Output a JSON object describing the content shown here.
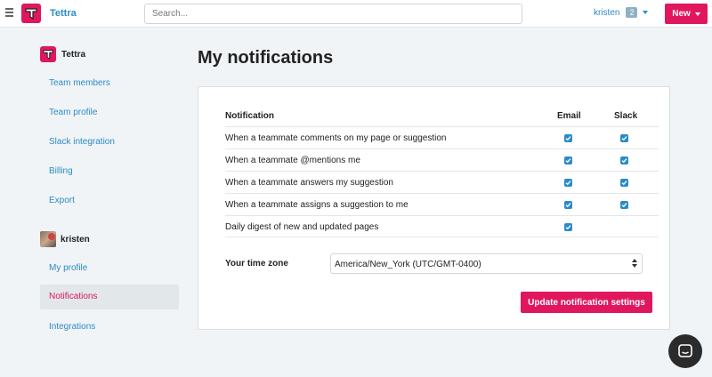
{
  "app": {
    "brand": "Tettra"
  },
  "search": {
    "placeholder": "Search..."
  },
  "user_menu": {
    "name": "kristen",
    "count": "2"
  },
  "new_button": {
    "label": "New"
  },
  "sidebar": {
    "org_name": "Tettra",
    "org_links": [
      "Team members",
      "Team profile",
      "Slack integration",
      "Billing",
      "Export"
    ],
    "user_name": "kristen",
    "user_links": [
      "My profile",
      "Notifications",
      "Integrations"
    ],
    "active_item": "Notifications"
  },
  "main": {
    "title": "My notifications",
    "table": {
      "headers": [
        "Notification",
        "Email",
        "Slack"
      ],
      "rows": [
        {
          "label": "When a teammate comments on my page or suggestion",
          "email": true,
          "slack": true
        },
        {
          "label": "When a teammate @mentions me",
          "email": true,
          "slack": true
        },
        {
          "label": "When a teammate answers my suggestion",
          "email": true,
          "slack": true
        },
        {
          "label": "When a teammate assigns a suggestion to me",
          "email": true,
          "slack": true
        },
        {
          "label": "Daily digest of new and updated pages",
          "email": true,
          "slack": null
        }
      ]
    },
    "timezone": {
      "label": "Your time zone",
      "value": "America/New_York (UTC/GMT-0400)"
    },
    "update_button": "Update notification settings"
  },
  "colors": {
    "accent": "#e0175f",
    "link": "#2a8bc6",
    "checkbox": "#2a8bc6"
  },
  "icons": [
    "hamburger-icon",
    "tettra-logo-icon",
    "caret-down-icon",
    "check-icon",
    "chat-icon"
  ]
}
